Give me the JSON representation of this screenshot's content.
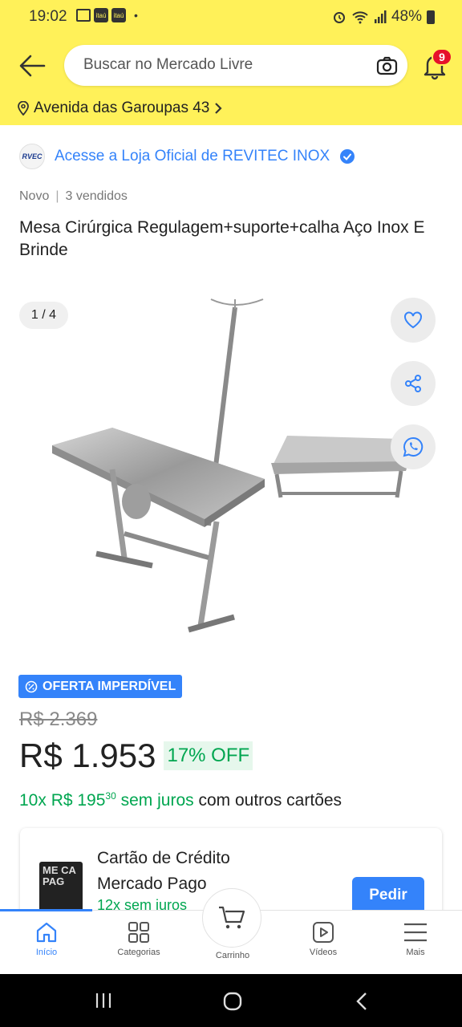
{
  "status_bar": {
    "time": "19:02",
    "battery": "48%",
    "bank_label_1": "itaú",
    "bank_label_2": "itaú",
    "dot": "•"
  },
  "header": {
    "search_placeholder": "Buscar no Mercado Livre",
    "cart_badge_count": "9",
    "address": "Avenida das Garoupas 43"
  },
  "store": {
    "logo_text": "RVEC",
    "link_text": "Acesse a Loja Oficial de REVITEC INOX"
  },
  "product": {
    "condition": "Novo",
    "sold": "3 vendidos",
    "separator": "|",
    "title": "Mesa Cirúrgica Regulagem+suporte+calha Aço Inox E Brinde",
    "image_counter": "1 / 4"
  },
  "pricing": {
    "badge": "OFERTA IMPERDÍVEL",
    "old_price": "R$ 2.369",
    "price": "R$ 1.953",
    "discount": "17% OFF",
    "installments_green": "10x R$ 195",
    "installments_cents": "30",
    "installments_free": " sem juros",
    "installments_rest": " com outros cartões"
  },
  "card_promo": {
    "title_line1": "Cartão de Crédito",
    "title_line2": "Mercado Pago",
    "subtitle": "12x sem juros",
    "button": "Pedir",
    "card_art": "ME CA PAG"
  },
  "bottom_nav": {
    "items": [
      {
        "label": "Início",
        "icon": "home-icon",
        "active": true
      },
      {
        "label": "Categorias",
        "icon": "grid-icon"
      },
      {
        "label": "Carrinho",
        "icon": "cart-icon"
      },
      {
        "label": "Vídeos",
        "icon": "video-icon"
      },
      {
        "label": "Mais",
        "icon": "menu-icon"
      }
    ]
  },
  "colors": {
    "brand_yellow": "#fff159",
    "accent_blue": "#3483fa",
    "green": "#00a650",
    "badge_red": "#e6112b"
  }
}
